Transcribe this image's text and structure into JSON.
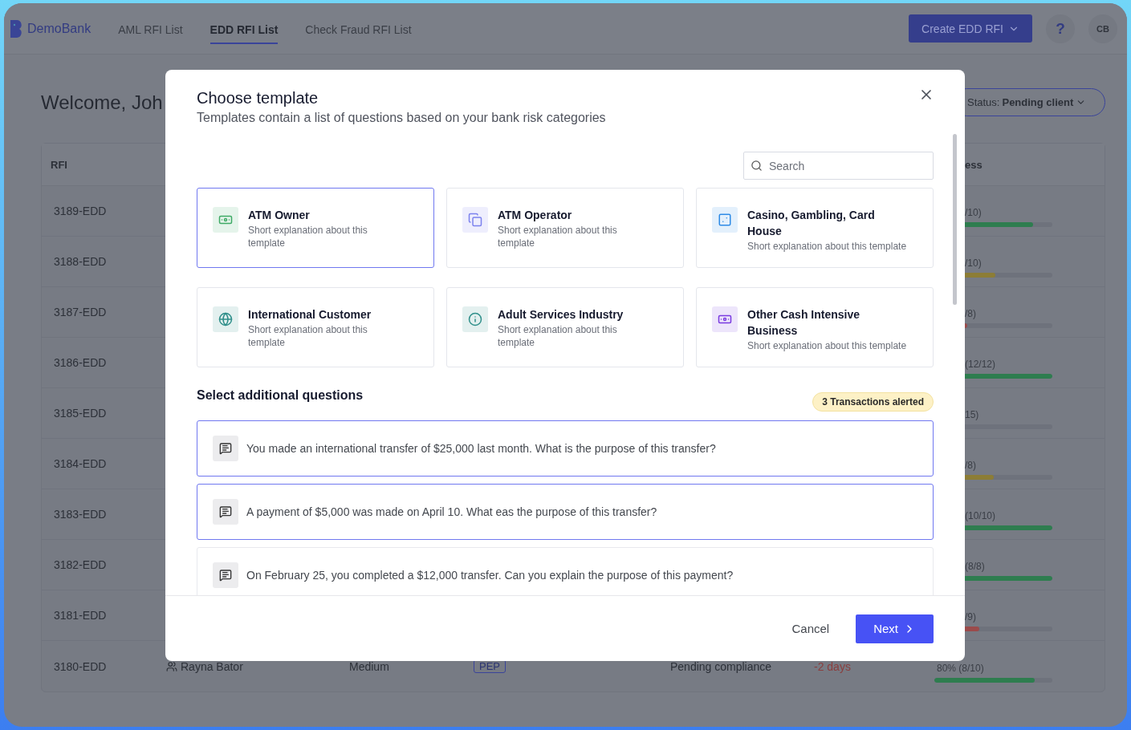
{
  "app": {
    "logo": "DemoBank",
    "nav": [
      {
        "label": "AML RFI List",
        "selected": false
      },
      {
        "label": "EDD RFI List",
        "selected": true
      },
      {
        "label": "Check Fraud RFI List",
        "selected": false
      }
    ],
    "create_button": "Create EDD RFI",
    "help": "?",
    "avatar": "CB"
  },
  "welcome": "Welcome, Joh",
  "status_filter": {
    "label": "Status:",
    "value": "Pending client"
  },
  "table": {
    "columns": [
      "RFI",
      "ess"
    ],
    "rows": [
      {
        "rfi": "3189-EDD",
        "progress": {
          "reading": "/10)",
          "level": 0.84,
          "color": "#2e7d4f"
        }
      },
      {
        "rfi": "3188-EDD",
        "progress": {
          "reading": "/10)",
          "level": 0.52,
          "color": "#8c7d36"
        }
      },
      {
        "rfi": "3187-EDD",
        "progress": {
          "reading": "/8)",
          "level": 0.28,
          "color": "#9b4b4b"
        }
      },
      {
        "rfi": "3186-EDD",
        "progress": {
          "reading": "(12/12)",
          "level": 1,
          "color": "#2e7d4f"
        }
      },
      {
        "rfi": "3185-EDD",
        "progress": {
          "reading": "15)",
          "level": 0
        }
      },
      {
        "rfi": "3184-EDD",
        "progress": {
          "reading": "/8)",
          "level": 0.5,
          "color": "#8c7d36"
        }
      },
      {
        "rfi": "3183-EDD",
        "progress": {
          "reading": "(10/10)",
          "level": 1,
          "color": "#2e7d4f"
        }
      },
      {
        "rfi": "3182-EDD",
        "progress": {
          "reading": "(8/8)",
          "level": 1,
          "color": "#2e7d4f"
        }
      },
      {
        "rfi": "3181-EDD",
        "progress": {
          "reading": "/9)",
          "level": 0.38,
          "color": "#9b4b4b"
        }
      },
      {
        "rfi": "3180-EDD",
        "client": "Rayna Bator",
        "risk": "Medium",
        "tag": "PEP",
        "status": "Pending compliance",
        "due": "-2 days",
        "progress": {
          "reading": "80% (8/10)",
          "level": 0.85,
          "color": "#2e7d4f"
        }
      }
    ]
  },
  "modal": {
    "title": "Choose template",
    "subtitle": "Templates contain a list of questions based on your bank risk categories",
    "search": {
      "placeholder": "Search"
    },
    "templates": [
      {
        "title": "ATM Owner",
        "description": "Short explanation about this template",
        "color": "#3faa66",
        "selected": true
      },
      {
        "title": "ATM Operator",
        "description": "Short explanation about this template",
        "color": "#7c82ee",
        "selected": false
      },
      {
        "title": "Casino, Gambling, Card House",
        "description": "Short explanation about this template",
        "color": "#2f8be6",
        "selected": false
      },
      {
        "title": "International Customer",
        "description": "Short explanation about this template",
        "color": "#2f8f8a",
        "selected": false
      },
      {
        "title": "Adult Services Industry",
        "description": "Short explanation about this template",
        "color": "#2f8f8a",
        "selected": false
      },
      {
        "title": "Other Cash Intensive Business",
        "description": "Short explanation about this template",
        "color": "#7a3be0",
        "selected": false
      }
    ],
    "questions_title": "Select additional questions",
    "alert_badge": "3 Transactions alerted",
    "questions": [
      {
        "text": "You made an international transfer of $25,000 last month. What is the purpose of this transfer?",
        "selected": true
      },
      {
        "text": "A payment of $5,000 was made on April 10. What eas the purpose of this transfer?",
        "selected": true
      },
      {
        "text": "On February 25, you completed a $12,000 transfer. Can you explain the purpose of this payment?",
        "selected": false
      }
    ],
    "buttons": {
      "cancel": "Cancel",
      "next": "Next"
    }
  }
}
